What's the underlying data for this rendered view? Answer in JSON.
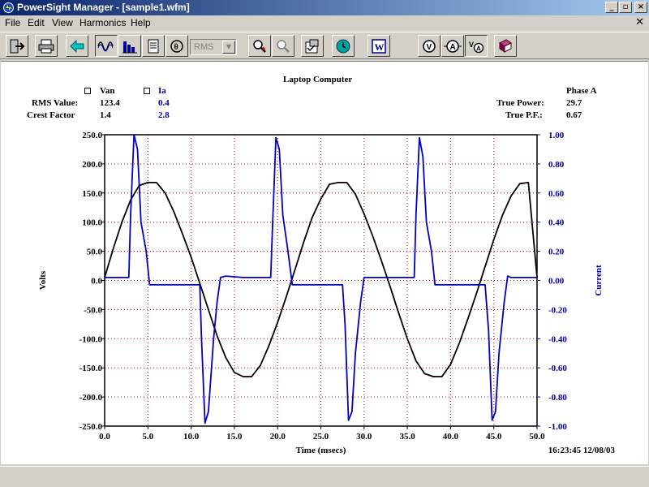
{
  "window": {
    "title": "PowerSight Manager - [sample1.wfm]",
    "controls": {
      "minimize": "_",
      "maximize": "▫",
      "close": "×"
    }
  },
  "menu": [
    {
      "label": "File"
    },
    {
      "label": "Edit"
    },
    {
      "label": "View"
    },
    {
      "label": "Harmonics"
    },
    {
      "label": "Help"
    }
  ],
  "toolbar": {
    "buttons": [
      "exit-icon",
      "print-icon",
      "back-arrow-icon",
      "waveform-icon",
      "harmonics-bars-icon",
      "report-icon",
      "phase-angle-icon",
      "zoom-in-icon",
      "zoom-out-icon",
      "properties-icon",
      "refresh-icon",
      "word-icon",
      "voltage-icon",
      "current-icon",
      "volt-amp-icon",
      "book-icon"
    ],
    "rms_select": "RMS"
  },
  "chart_header": {
    "title": "Laptop Computer",
    "phase": "Phase A",
    "series": [
      {
        "name": "Van",
        "rms_label": "RMS Value:",
        "rms": "123.4",
        "crest_label": "Crest Factor",
        "crest": "1.4",
        "color": "#000000"
      },
      {
        "name": "Ia",
        "rms": "0.4",
        "crest": "2.8",
        "color": "#0000c0"
      }
    ],
    "true_power_label": "True Power:",
    "true_power": "29.7",
    "true_pf_label": "True P.F.:",
    "true_pf": "0.67"
  },
  "chart_data": {
    "type": "line",
    "xlabel": "Time (msecs)",
    "ylabel": "Volts",
    "y2label": "Current",
    "xlim": [
      0,
      50
    ],
    "ylim": [
      -250,
      250
    ],
    "y2lim": [
      -1,
      1
    ],
    "xticks": [
      "0.0",
      "5.0",
      "10.0",
      "15.0",
      "20.0",
      "25.0",
      "30.0",
      "35.0",
      "40.0",
      "45.0",
      "50.0"
    ],
    "yticks": [
      "250.0",
      "200.0",
      "150.0",
      "100.0",
      "50.0",
      "0.0",
      "-50.0",
      "-100.0",
      "-150.0",
      "-200.0",
      "-250.0"
    ],
    "y2ticks": [
      "1.00",
      "0.80",
      "0.60",
      "0.40",
      "0.20",
      "0.00",
      "-0.20",
      "-0.40",
      "-0.60",
      "-0.80",
      "-1.00"
    ],
    "grid": true,
    "timestamp": "16:23:45 12/08/03",
    "series": [
      {
        "name": "Van",
        "axis": "left",
        "color": "#000000",
        "x": [
          0,
          1,
          2,
          3,
          4,
          5,
          6,
          7,
          8,
          9,
          10,
          11,
          12,
          13,
          14,
          15,
          16,
          17,
          18,
          19,
          20,
          21,
          22,
          23,
          24,
          25,
          26,
          27,
          28,
          29,
          30,
          31,
          32,
          33,
          34,
          35,
          36,
          37,
          38,
          39,
          40,
          41,
          42,
          43,
          44,
          45,
          46,
          47,
          48,
          49,
          50
        ],
        "values": [
          5,
          55,
          100,
          138,
          163,
          168,
          168,
          150,
          118,
          80,
          40,
          -5,
          -50,
          -95,
          -132,
          -158,
          -165,
          -165,
          -146,
          -112,
          -72,
          -28,
          18,
          65,
          108,
          140,
          165,
          168,
          168,
          148,
          114,
          76,
          34,
          -10,
          -56,
          -100,
          -138,
          -160,
          -165,
          -165,
          -144,
          -108,
          -66,
          -22,
          24,
          70,
          112,
          145,
          166,
          168,
          5
        ]
      },
      {
        "name": "Ia",
        "axis": "right",
        "color": "#0000c0",
        "x": [
          0,
          2.8,
          3.0,
          3.4,
          3.8,
          4.2,
          4.8,
          5.2,
          6,
          8,
          10,
          11,
          11.2,
          11.6,
          12.0,
          12.6,
          13.0,
          13.4,
          14,
          16,
          18,
          19.2,
          19.4,
          19.8,
          20.2,
          20.6,
          21.2,
          21.7,
          23,
          25,
          27.5,
          27.8,
          28.2,
          28.6,
          29.0,
          29.6,
          30.0,
          30.3,
          32,
          34,
          35.8,
          36.0,
          36.4,
          36.8,
          37.2,
          37.8,
          38.2,
          38.6,
          40,
          42,
          44,
          44.4,
          44.8,
          45.2,
          45.6,
          46.2,
          46.6,
          47,
          48,
          50
        ],
        "values": [
          0.02,
          0.02,
          0.45,
          1.0,
          0.9,
          0.4,
          0.2,
          -0.03,
          -0.03,
          -0.03,
          -0.03,
          -0.03,
          -0.4,
          -0.98,
          -0.9,
          -0.4,
          -0.15,
          0.02,
          0.03,
          0.02,
          0.02,
          0.02,
          0.35,
          0.98,
          0.9,
          0.45,
          0.2,
          -0.03,
          -0.03,
          -0.03,
          -0.03,
          -0.3,
          -0.96,
          -0.9,
          -0.5,
          -0.15,
          0.02,
          0.02,
          0.02,
          0.02,
          0.02,
          0.45,
          0.98,
          0.85,
          0.4,
          0.2,
          -0.03,
          -0.03,
          -0.03,
          -0.03,
          -0.03,
          -0.35,
          -0.96,
          -0.9,
          -0.5,
          -0.15,
          0.03,
          0.02,
          0.02,
          0.02
        ]
      }
    ]
  }
}
